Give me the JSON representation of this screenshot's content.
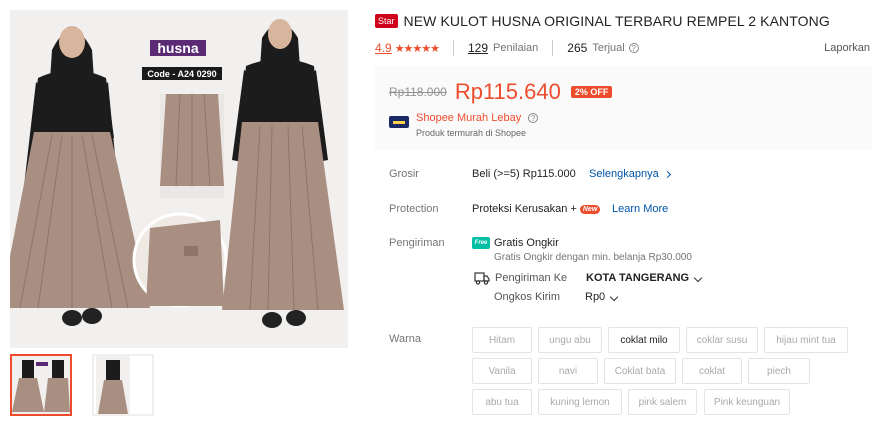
{
  "product": {
    "badge": "Star",
    "title": "NEW KULOT HUSNA ORIGINAL TERBARU REMPEL 2 KANTONG"
  },
  "gallery": {
    "brand_label": "husna",
    "code_label": "Code - A24  0290",
    "thumbnail_count": 2,
    "active_thumbnail": 1
  },
  "stats": {
    "rating": "4.9",
    "stars": "★★★★★",
    "reviews_count": "129",
    "reviews_label": "Penilaian",
    "sold_count": "265",
    "sold_label": "Terjual",
    "report_label": "Laporkan"
  },
  "price": {
    "original": "Rp118.000",
    "current": "Rp115.640",
    "discount": "2% OFF",
    "promo_title": "Shopee Murah Lebay",
    "promo_subtitle": "Produk termurah di Shopee"
  },
  "details": {
    "grosir_label": "Grosir",
    "grosir_value": "Beli (>=5) Rp115.000",
    "grosir_link": "Selengkapnya",
    "protection_label": "Protection",
    "protection_value": "Proteksi Kerusakan +",
    "protection_badge": "New",
    "protection_link": "Learn More",
    "shipping_label": "Pengiriman",
    "free_shipping": "Gratis Ongkir",
    "free_shipping_icon_text": "Free",
    "free_shipping_note": "Gratis Ongkir dengan min. belanja Rp30.000",
    "ship_to_label": "Pengiriman Ke",
    "ship_to_value": "KOTA TANGERANG",
    "cost_label": "Ongkos Kirim",
    "cost_value": "Rp0"
  },
  "variations": {
    "label": "Warna",
    "options": [
      {
        "name": "Hitam",
        "enabled": false
      },
      {
        "name": "ungu abu",
        "enabled": false
      },
      {
        "name": "coklat milo",
        "enabled": true
      },
      {
        "name": "coklar susu",
        "enabled": false
      },
      {
        "name": "hijau mint tua",
        "enabled": false
      },
      {
        "name": "Vanila",
        "enabled": false
      },
      {
        "name": "navi",
        "enabled": false
      },
      {
        "name": "Coklat bata",
        "enabled": false
      },
      {
        "name": "coklat",
        "enabled": false
      },
      {
        "name": "piech",
        "enabled": false
      },
      {
        "name": "abu tua",
        "enabled": false
      },
      {
        "name": "kuning lemon",
        "enabled": false
      },
      {
        "name": "pink salem",
        "enabled": false
      },
      {
        "name": "Pink keunguan",
        "enabled": false
      }
    ]
  },
  "colors": {
    "accent": "#ee4d2d",
    "link": "#0055aa",
    "skirt": "#a98e82",
    "top": "#1c1c1c"
  }
}
